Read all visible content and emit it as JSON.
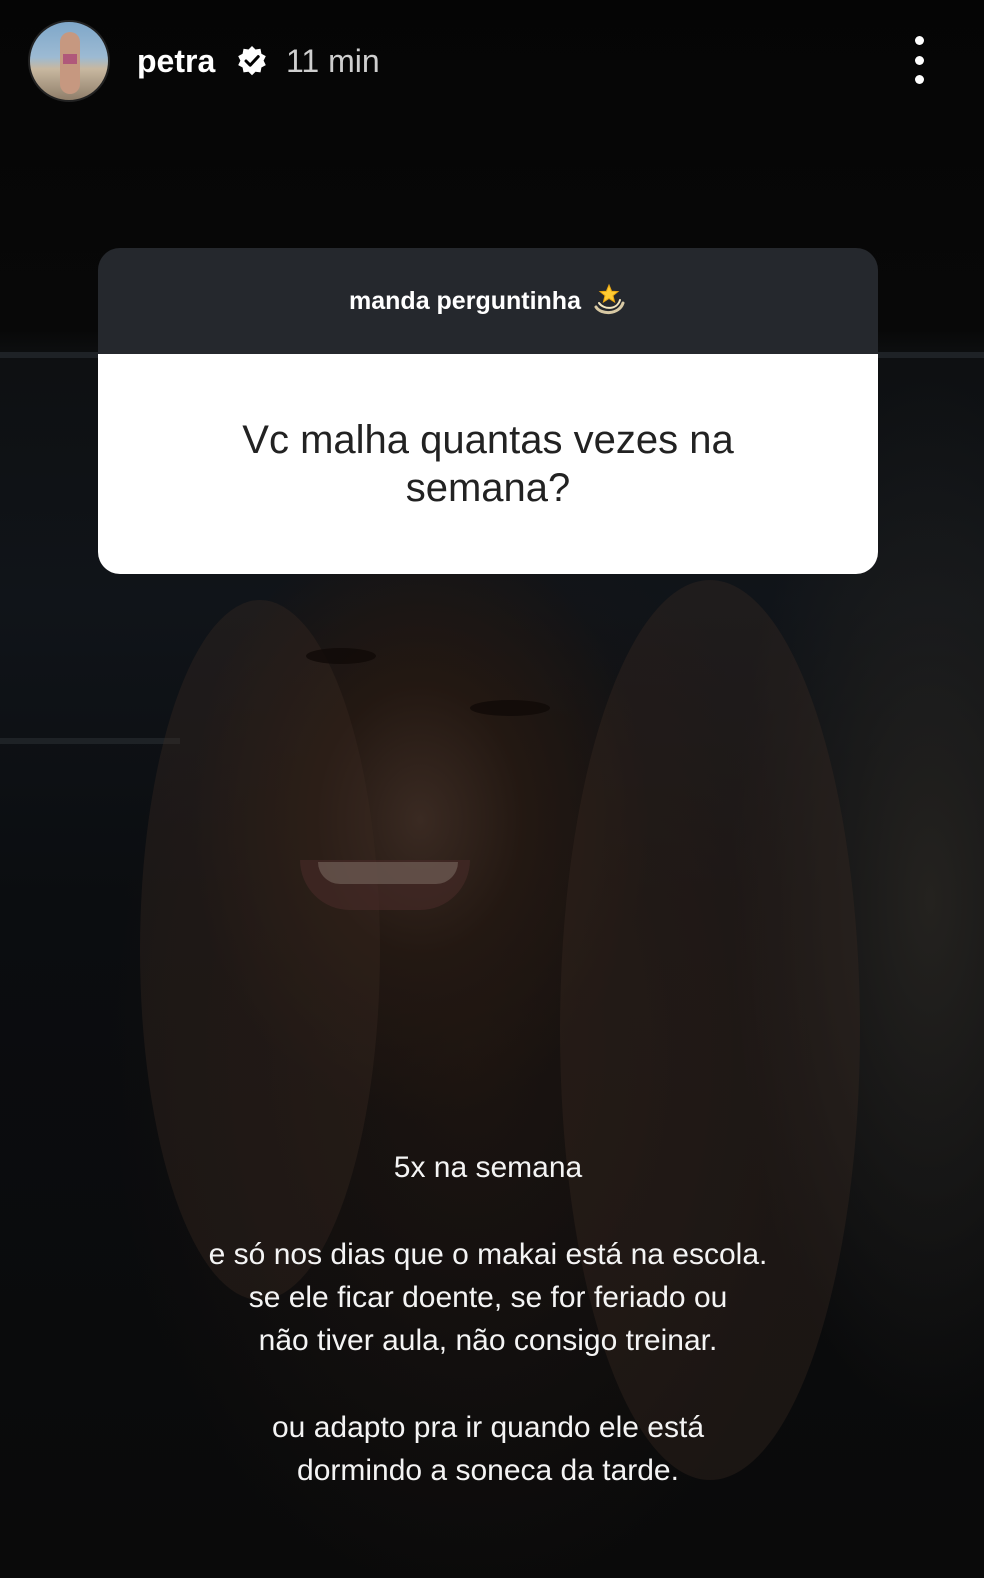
{
  "header": {
    "username": "petra",
    "verified": true,
    "timestamp": "11 min",
    "avatar_icon": "profile-avatar",
    "menu_icon": "more-vertical-icon"
  },
  "sticker": {
    "title": "manda perguntinha",
    "title_emoji": "💫",
    "question": "Vc malha quantas vezes na semana?"
  },
  "answer": {
    "line_1": "5x na semana",
    "paragraph_2": [
      "e só nos dias que o makai está na escola.",
      "se ele ficar doente, se for feriado ou",
      "não tiver aula, não consigo treinar."
    ],
    "paragraph_3": [
      "ou adapto pra ir quando ele está",
      "dormindo a soneca da tarde."
    ]
  },
  "colors": {
    "background": "#000000",
    "sticker_header": "#25282d",
    "sticker_body": "#ffffff",
    "text": "#ffffff"
  }
}
